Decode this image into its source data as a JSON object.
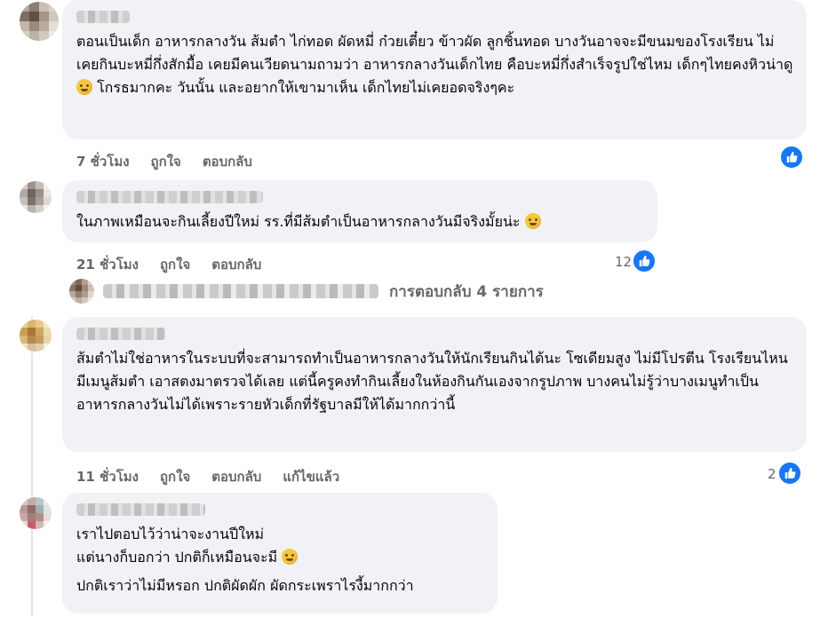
{
  "comments": [
    {
      "text": "ตอนเป็นเด็ก อาหารกลางวัน ส้มตำ ไก่ทอด ผัดหมี่ ก๋วยเตี๋ยว ข้าวผัด ลูกชิ้นทอด บางวันอาจจะมีขนมของโรงเรียน ไม่เคยกินบะหมี่กึ่งสักมื้อ เคยมีคนเวียดนามถามว่า อาหารกลางวันเด็กไทย คือบะหมี่กึ่งสำเร็จรูปใช่ไหม เด็กๆไทยคงหิวน่าดู",
      "text_after_emoji": " โกรธมากคะ วันนั้น และอยากให้เขามาเห็น เด็กไทยไม่เคยอดจริงๆคะ",
      "emoji": "sad-face",
      "time": "7 ชั่วโมง",
      "like": "ถูกใจ",
      "reply": "ตอบกลับ",
      "reaction_count": ""
    },
    {
      "text": "ในภาพเหมือนจะกินเลี้ยงปีใหม่ รร.ที่มีส้มตำเป็นอาหารกลางวันมีจริงมั้ยน่ะ ",
      "emoji": "crying-face",
      "time": "21 ชั่วโมง",
      "like": "ถูกใจ",
      "reply": "ตอบกลับ",
      "reaction_count": "12"
    },
    {
      "text": "ส้มตำไม่ใช่อาหารในระบบที่จะสามารถทำเป็นอาหารกลางวันให้นักเรียนกินได้นะ โซเดียมสูง ไม่มีโปรตีน โรงเรียนไหนมีเมนูส้มตำ เอาสตงมาตรวจได้เลย แต่นี้ครูคงทำกินเลี้ยงในห้องกินกันเองจากรูปภาพ บางคนไม่รู้ว่าบางเมนูทำเป็นอาหารกลางวันไม่ได้เพราะรายหัวเด็กที่รัฐบาลมีให้ได้มากกว่านี้",
      "time": "11 ชั่วโมง",
      "like": "ถูกใจ",
      "reply": "ตอบกลับ",
      "edited": "แก้ไขแล้ว",
      "reaction_count": "2"
    },
    {
      "line1": "เราไปตอบไว้ว่าน่าจะงานปีใหม่",
      "line2": "แต่นางก็บอกว่า ปกติก็เหมือนจะมี ",
      "emoji": "rolling-eyes-face",
      "line3": "ปกติเราว่าไม่มีหรอก ปกติผัดผัก ผัดกระเพราไรงี้มากกว่า"
    }
  ],
  "replies_link": "การตอบกลับ 4 รายการ",
  "colors": {
    "bubble": "#f0f2f5",
    "meta": "#65676b",
    "like_blue": "#1877f2"
  },
  "icons": {
    "like": "thumbs-up-icon"
  }
}
